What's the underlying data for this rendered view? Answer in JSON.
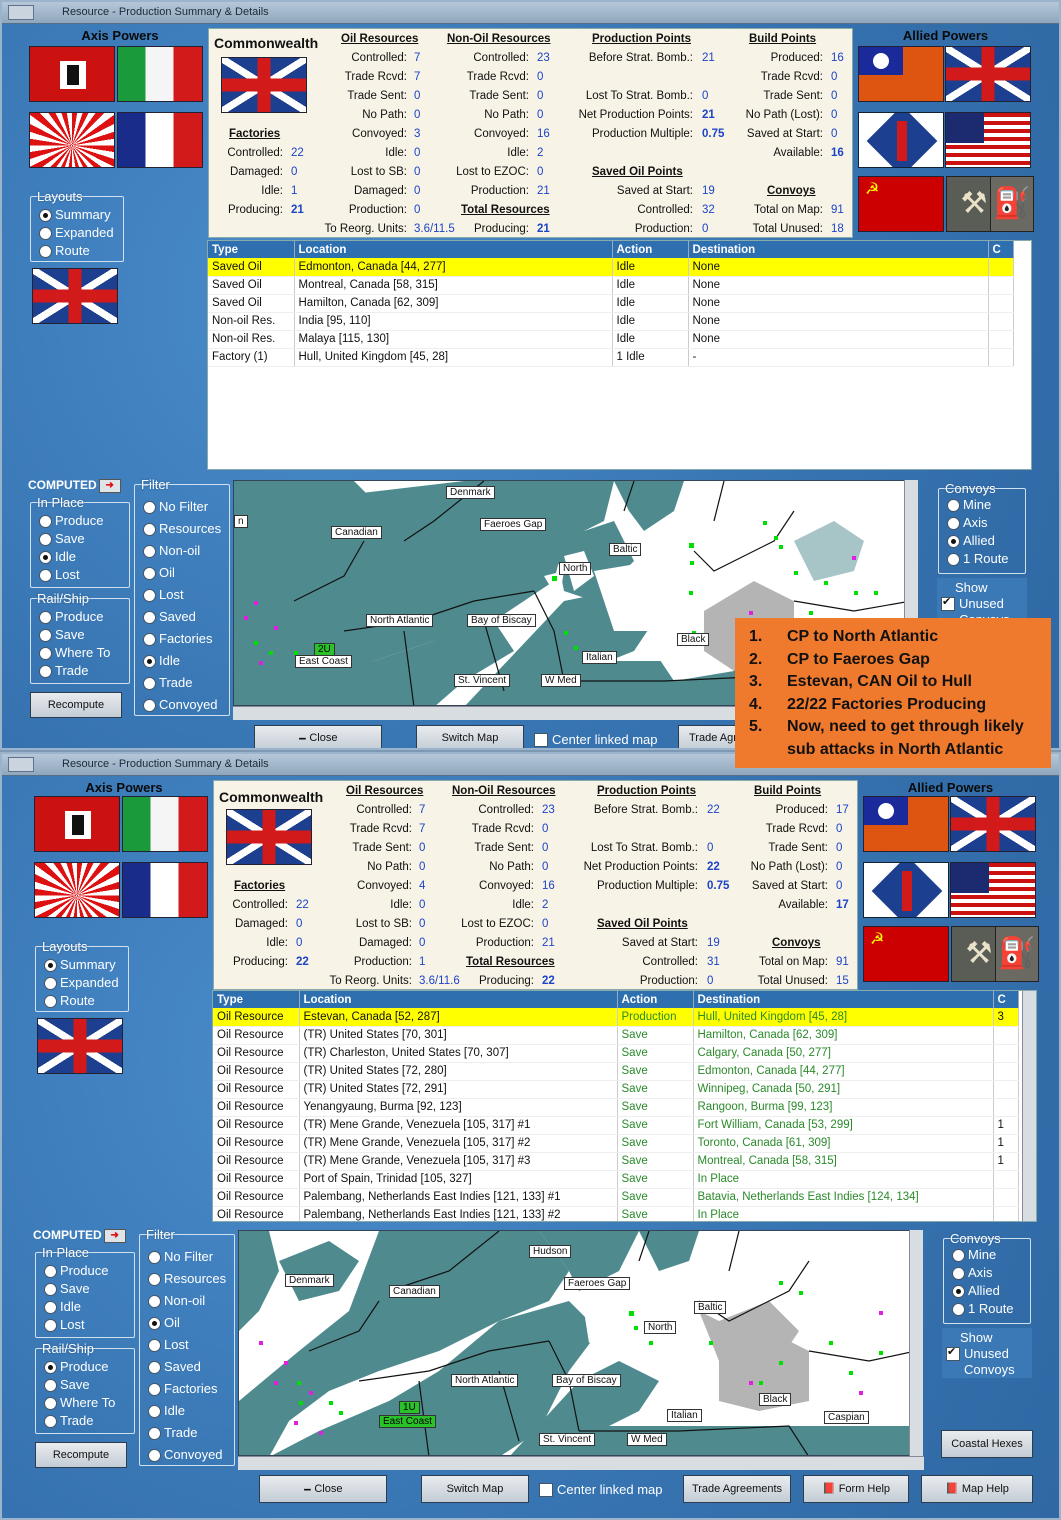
{
  "w1": {
    "title": "Resource - Production Summary & Details",
    "axis_label": "Axis Powers",
    "allied_label": "Allied Powers",
    "country": "Commonwealth",
    "factories": {
      "h": "Factories",
      "rows": [
        [
          "Controlled:",
          "22"
        ],
        [
          "Damaged:",
          "0"
        ],
        [
          "Idle:",
          "1"
        ],
        [
          "Producing:",
          "21"
        ]
      ]
    },
    "oil": {
      "h": "Oil Resources",
      "rows": [
        [
          "Controlled:",
          "7"
        ],
        [
          "Trade Rcvd:",
          "7"
        ],
        [
          "Trade Sent:",
          "0"
        ],
        [
          "No Path:",
          "0"
        ],
        [
          "Convoyed:",
          "3"
        ],
        [
          "Idle:",
          "0"
        ],
        [
          "Lost to SB:",
          "0"
        ],
        [
          "Damaged:",
          "0"
        ],
        [
          "Production:",
          "0"
        ]
      ]
    },
    "reorg": [
      "To Reorg. Units:",
      "3.6/11.5"
    ],
    "nonoil": {
      "h": "Non-Oil Resources",
      "rows": [
        [
          "Controlled:",
          "23"
        ],
        [
          "Trade Rcvd:",
          "0"
        ],
        [
          "Trade Sent:",
          "0"
        ],
        [
          "No Path:",
          "0"
        ],
        [
          "Convoyed:",
          "16"
        ],
        [
          "Idle:",
          "2"
        ],
        [
          "Lost to EZOC:",
          "0"
        ],
        [
          "Production:",
          "21"
        ]
      ]
    },
    "total": {
      "h": "Total Resources",
      "label": "Producing:",
      "value": "21"
    },
    "pp": {
      "h": "Production Points",
      "rows": [
        [
          "Before Strat. Bomb.:",
          "21"
        ],
        [
          "",
          ""
        ],
        [
          "Lost To Strat. Bomb.:",
          "0"
        ],
        [
          "Net Production Points:",
          "21"
        ],
        [
          "Production Multiple:",
          "0.75"
        ]
      ]
    },
    "sop": {
      "h": "Saved Oil Points",
      "rows": [
        [
          "Saved at Start:",
          "19"
        ],
        [
          "Controlled:",
          "32"
        ],
        [
          "Production:",
          "0"
        ]
      ]
    },
    "bp": {
      "h": "Build Points",
      "rows": [
        [
          "Produced:",
          "16"
        ],
        [
          "Trade Rcvd:",
          "0"
        ],
        [
          "Trade Sent:",
          "0"
        ],
        [
          "No Path (Lost):",
          "0"
        ],
        [
          "Saved at Start:",
          "0"
        ],
        [
          "Available:",
          "16"
        ]
      ]
    },
    "conv": {
      "h": "Convoys",
      "rows": [
        [
          "Total on Map:",
          "91"
        ],
        [
          "Total Unused:",
          "18"
        ]
      ]
    },
    "cols": [
      "Type",
      "Location",
      "Action",
      "Destination",
      "C"
    ],
    "rows": [
      [
        "Saved Oil",
        "Edmonton, Canada [44, 277]",
        "Idle",
        "None",
        ""
      ],
      [
        "Saved Oil",
        "Montreal, Canada [58, 315]",
        "Idle",
        "None",
        ""
      ],
      [
        "Saved Oil",
        "Hamilton, Canada [62, 309]",
        "Idle",
        "None",
        ""
      ],
      [
        "Non-oil Res.",
        "India [95, 110]",
        "Idle",
        "None",
        ""
      ],
      [
        "Non-oil Res.",
        "Malaya [115, 130]",
        "Idle",
        "None",
        ""
      ],
      [
        "Factory (1)",
        "Hull, United Kingdom [45, 28]",
        "1 Idle",
        "-",
        ""
      ]
    ],
    "layouts": {
      "t": "Layouts",
      "items": [
        "Summary",
        "Expanded",
        "Route"
      ],
      "sel": 0
    },
    "computed": "COMPUTED",
    "inplace": {
      "t": "In Place",
      "items": [
        "Produce",
        "Save",
        "Idle",
        "Lost"
      ],
      "sel": 2
    },
    "railship": {
      "t": "Rail/Ship",
      "items": [
        "Produce",
        "Save",
        "Where To",
        "Trade"
      ],
      "sel": -1
    },
    "filter": {
      "t": "Filter",
      "items": [
        "No Filter",
        "Resources",
        "Non-oil",
        "Oil",
        "Lost",
        "Saved",
        "Factories",
        "Idle",
        "Trade",
        "Convoyed"
      ],
      "sel": 7
    },
    "convoys": {
      "t": "Convoys",
      "items": [
        "Mine",
        "Axis",
        "Allied",
        "1 Route"
      ],
      "sel": 2
    },
    "show": "Show",
    "unused": "Unused",
    "convoys_word": "Convoys",
    "recompute": "Recompute",
    "close": "Close",
    "switchmap": "Switch Map",
    "center": "Center linked map",
    "trade": "Trade Agr",
    "maplabels": [
      "Denmark",
      "Canadian",
      "Faeroes Gap",
      "Baltic",
      "North",
      "North Atlantic",
      "Bay of Biscay",
      "Black",
      "Italian",
      "East Coast",
      "St. Vincent",
      "W Med",
      "2U",
      "n"
    ]
  },
  "note": {
    "items": [
      "CP to North Atlantic",
      "CP to Faeroes Gap",
      "Estevan, CAN Oil to Hull",
      "22/22 Factories Producing",
      "Now, need to get through likely sub attacks in North Atlantic"
    ],
    "nums": [
      "1.",
      "2.",
      "3.",
      "4.",
      "5."
    ]
  },
  "w2": {
    "title": "Resource - Production Summary & Details",
    "axis_label": "Axis Powers",
    "allied_label": "Allied Powers",
    "country": "Commonwealth",
    "factories": {
      "h": "Factories",
      "rows": [
        [
          "Controlled:",
          "22"
        ],
        [
          "Damaged:",
          "0"
        ],
        [
          "Idle:",
          "0"
        ],
        [
          "Producing:",
          "22"
        ]
      ]
    },
    "oil": {
      "h": "Oil Resources",
      "rows": [
        [
          "Controlled:",
          "7"
        ],
        [
          "Trade Rcvd:",
          "7"
        ],
        [
          "Trade Sent:",
          "0"
        ],
        [
          "No Path:",
          "0"
        ],
        [
          "Convoyed:",
          "4"
        ],
        [
          "Idle:",
          "0"
        ],
        [
          "Lost to SB:",
          "0"
        ],
        [
          "Damaged:",
          "0"
        ],
        [
          "Production:",
          "1"
        ]
      ]
    },
    "reorg": [
      "To Reorg. Units:",
      "3.6/11.6"
    ],
    "nonoil": {
      "h": "Non-Oil Resources",
      "rows": [
        [
          "Controlled:",
          "23"
        ],
        [
          "Trade Rcvd:",
          "0"
        ],
        [
          "Trade Sent:",
          "0"
        ],
        [
          "No Path:",
          "0"
        ],
        [
          "Convoyed:",
          "16"
        ],
        [
          "Idle:",
          "2"
        ],
        [
          "Lost to EZOC:",
          "0"
        ],
        [
          "Production:",
          "21"
        ]
      ]
    },
    "total": {
      "h": "Total Resources",
      "label": "Producing:",
      "value": "22"
    },
    "pp": {
      "h": "Production Points",
      "rows": [
        [
          "Before Strat. Bomb.:",
          "22"
        ],
        [
          "",
          ""
        ],
        [
          "Lost To Strat. Bomb.:",
          "0"
        ],
        [
          "Net Production Points:",
          "22"
        ],
        [
          "Production Multiple:",
          "0.75"
        ]
      ]
    },
    "sop": {
      "h": "Saved Oil Points",
      "rows": [
        [
          "Saved at Start:",
          "19"
        ],
        [
          "Controlled:",
          "31"
        ],
        [
          "Production:",
          "0"
        ]
      ]
    },
    "bp": {
      "h": "Build Points",
      "rows": [
        [
          "Produced:",
          "17"
        ],
        [
          "Trade Rcvd:",
          "0"
        ],
        [
          "Trade Sent:",
          "0"
        ],
        [
          "No Path (Lost):",
          "0"
        ],
        [
          "Saved at Start:",
          "0"
        ],
        [
          "Available:",
          "17"
        ]
      ]
    },
    "conv": {
      "h": "Convoys",
      "rows": [
        [
          "Total on Map:",
          "91"
        ],
        [
          "Total Unused:",
          "15"
        ]
      ]
    },
    "cols": [
      "Type",
      "Location",
      "Action",
      "Destination",
      "C"
    ],
    "rows": [
      [
        "Oil Resource",
        "Estevan, Canada [52, 287]",
        "Production",
        "Hull, United Kingdom [45, 28]",
        "3"
      ],
      [
        "Oil Resource",
        "(TR) United States [70, 301]",
        "Save",
        "Hamilton, Canada [62, 309]",
        ""
      ],
      [
        "Oil Resource",
        "(TR) Charleston, United States [70, 307]",
        "Save",
        "Calgary, Canada [50, 277]",
        ""
      ],
      [
        "Oil Resource",
        "(TR) United States [72, 280]",
        "Save",
        "Edmonton, Canada [44, 277]",
        ""
      ],
      [
        "Oil Resource",
        "(TR) United States [72, 291]",
        "Save",
        "Winnipeg, Canada [50, 291]",
        ""
      ],
      [
        "Oil Resource",
        "Yenangyaung, Burma [92, 123]",
        "Save",
        "Rangoon, Burma [99, 123]",
        ""
      ],
      [
        "Oil Resource",
        "(TR) Mene Grande, Venezuela [105, 317] #1",
        "Save",
        "Fort William, Canada [53, 299]",
        "1"
      ],
      [
        "Oil Resource",
        "(TR) Mene Grande, Venezuela [105, 317] #2",
        "Save",
        "Toronto, Canada [61, 309]",
        "1"
      ],
      [
        "Oil Resource",
        "(TR) Mene Grande, Venezuela [105, 317] #3",
        "Save",
        "Montreal, Canada [58, 315]",
        "1"
      ],
      [
        "Oil Resource",
        "Port of Spain, Trinidad [105, 327]",
        "Save",
        "In Place",
        ""
      ],
      [
        "Oil Resource",
        "Palembang, Netherlands East Indies [121, 133] #1",
        "Save",
        "Batavia, Netherlands East Indies [124, 134]",
        ""
      ],
      [
        "Oil Resource",
        "Palembang, Netherlands East Indies [121, 133] #2",
        "Save",
        "In Place",
        ""
      ]
    ],
    "layouts": {
      "t": "Layouts",
      "items": [
        "Summary",
        "Expanded",
        "Route"
      ],
      "sel": 0
    },
    "computed": "COMPUTED",
    "inplace": {
      "t": "In Place",
      "items": [
        "Produce",
        "Save",
        "Idle",
        "Lost"
      ],
      "sel": -1
    },
    "railship": {
      "t": "Rail/Ship",
      "items": [
        "Produce",
        "Save",
        "Where To",
        "Trade"
      ],
      "sel": 0
    },
    "filter": {
      "t": "Filter",
      "items": [
        "No Filter",
        "Resources",
        "Non-oil",
        "Oil",
        "Lost",
        "Saved",
        "Factories",
        "Idle",
        "Trade",
        "Convoyed"
      ],
      "sel": 3
    },
    "convoys": {
      "t": "Convoys",
      "items": [
        "Mine",
        "Axis",
        "Allied",
        "1 Route"
      ],
      "sel": 2
    },
    "show": "Show",
    "unused": "Unused",
    "convoys_word": "Convoys",
    "recompute": "Recompute",
    "close": "Close",
    "switchmap": "Switch Map",
    "center": "Center linked map",
    "trade": "Trade Agreements",
    "formhelp": "Form Help",
    "maphelp": "Map Help",
    "coastal": "Coastal Hexes",
    "maplabels": [
      "Denmark",
      "Hudson",
      "Canadian",
      "Faeroes Gap",
      "Baltic",
      "North",
      "North Atlantic",
      "Bay of Biscay",
      "Black",
      "Italian",
      "Caspian",
      "East Coast",
      "St. Vincent",
      "W Med",
      "1U"
    ]
  }
}
